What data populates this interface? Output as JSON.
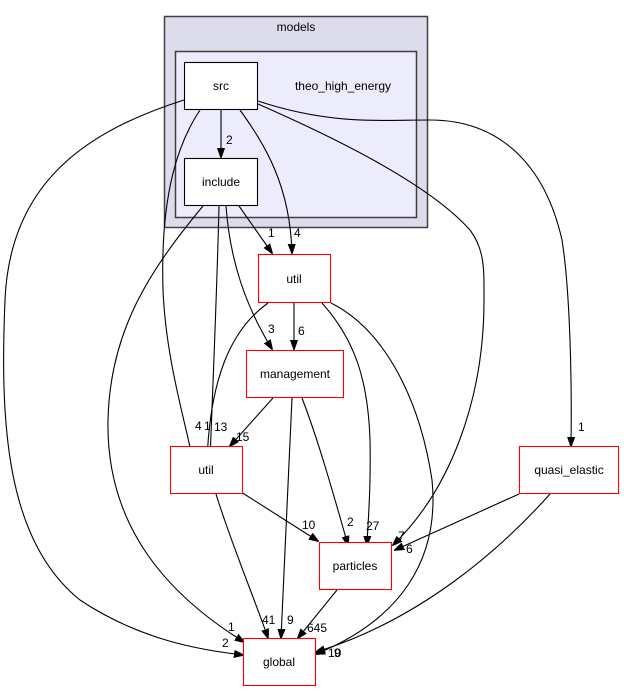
{
  "diagram": {
    "type": "directory-dependency-graph",
    "colors": {
      "outer_cluster_fill": "#dcdcec",
      "inner_cluster_fill": "#ececfc",
      "cluster_border": "#404040",
      "local_node_border": "#000000",
      "external_node_border": "#ff0000",
      "edge": "#000000"
    },
    "clusters": [
      {
        "id": "models",
        "label": "models"
      },
      {
        "id": "theo_high_energy",
        "label": "theo_high_energy",
        "parent": "models"
      }
    ],
    "nodes": [
      {
        "id": "src",
        "label": "src",
        "kind": "local"
      },
      {
        "id": "include",
        "label": "include",
        "kind": "local"
      },
      {
        "id": "util_top",
        "label": "util",
        "kind": "external"
      },
      {
        "id": "management",
        "label": "management",
        "kind": "external"
      },
      {
        "id": "util_mid",
        "label": "util",
        "kind": "external"
      },
      {
        "id": "quasi_elastic",
        "label": "quasi_elastic",
        "kind": "external"
      },
      {
        "id": "particles",
        "label": "particles",
        "kind": "external"
      },
      {
        "id": "global",
        "label": "global",
        "kind": "external"
      }
    ],
    "edges": [
      {
        "from": "src",
        "to": "include",
        "label": "2"
      },
      {
        "from": "src",
        "to": "util_top",
        "label": "4"
      },
      {
        "from": "src",
        "to": "util_mid",
        "label": "4"
      },
      {
        "from": "src",
        "to": "global",
        "label": "2"
      },
      {
        "from": "src",
        "to": "particles",
        "label": "7"
      },
      {
        "from": "src",
        "to": "quasi_elastic",
        "label": "1"
      },
      {
        "from": "include",
        "to": "util_top",
        "label": "1"
      },
      {
        "from": "include",
        "to": "management",
        "label": "3"
      },
      {
        "from": "include",
        "to": "util_mid",
        "label": "13"
      },
      {
        "from": "include",
        "to": "global",
        "label": "1"
      },
      {
        "from": "util_top",
        "to": "management",
        "label": "6"
      },
      {
        "from": "util_top",
        "to": "util_mid",
        "label": "1"
      },
      {
        "from": "util_top",
        "to": "particles",
        "label": "27"
      },
      {
        "from": "util_top",
        "to": "global",
        "label": "10"
      },
      {
        "from": "management",
        "to": "util_mid",
        "label": "15"
      },
      {
        "from": "management",
        "to": "particles",
        "label": "2"
      },
      {
        "from": "management",
        "to": "global",
        "label": "9"
      },
      {
        "from": "util_mid",
        "to": "particles",
        "label": "10"
      },
      {
        "from": "util_mid",
        "to": "global",
        "label": "41"
      },
      {
        "from": "quasi_elastic",
        "to": "particles",
        "label": "6"
      },
      {
        "from": "quasi_elastic",
        "to": "global",
        "label": "9"
      },
      {
        "from": "particles",
        "to": "global",
        "label": "645"
      }
    ]
  }
}
